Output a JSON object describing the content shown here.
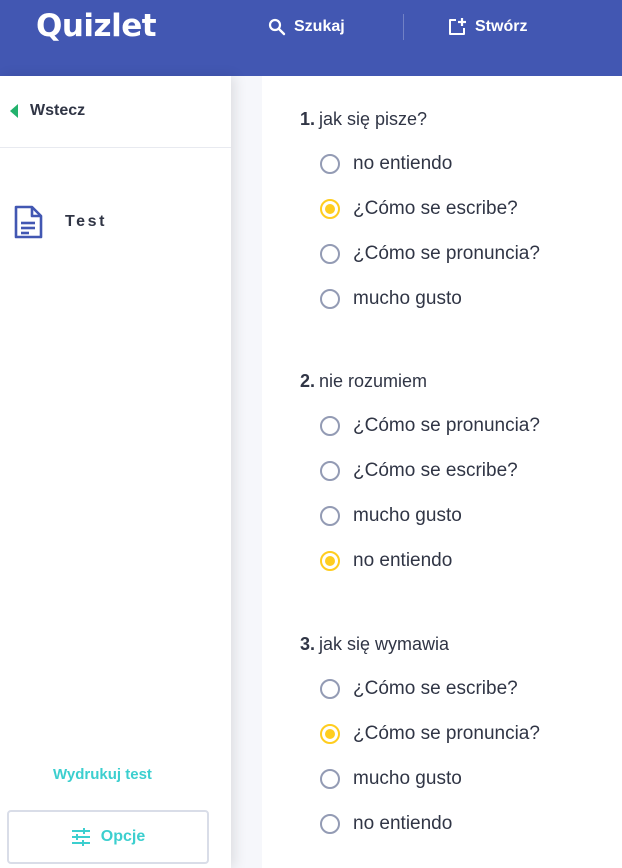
{
  "header": {
    "logo": "Quizlet",
    "search_label": "Szukaj",
    "create_label": "Stwórz",
    "brand_color": "#4257b2"
  },
  "sidebar": {
    "back_label": "Wstecz",
    "mode_label": "Test",
    "print_label": "Wydrukuj test",
    "options_label": "Opcje"
  },
  "questions": [
    {
      "number": "1.",
      "prompt": "jak się pisze?",
      "options": [
        {
          "label": "no entiendo",
          "selected": false
        },
        {
          "label": "¿Cómo se escribe?",
          "selected": true
        },
        {
          "label": "¿Cómo se pronuncia?",
          "selected": false
        },
        {
          "label": "mucho gusto",
          "selected": false
        }
      ]
    },
    {
      "number": "2.",
      "prompt": "nie rozumiem",
      "options": [
        {
          "label": "¿Cómo se pronuncia?",
          "selected": false
        },
        {
          "label": "¿Cómo se escribe?",
          "selected": false
        },
        {
          "label": "mucho gusto",
          "selected": false
        },
        {
          "label": "no entiendo",
          "selected": true
        }
      ]
    },
    {
      "number": "3.",
      "prompt": "jak się wymawia",
      "options": [
        {
          "label": "¿Cómo se escribe?",
          "selected": false
        },
        {
          "label": "¿Cómo se pronuncia?",
          "selected": true
        },
        {
          "label": "mucho gusto",
          "selected": false
        },
        {
          "label": "no entiendo",
          "selected": false
        }
      ]
    }
  ]
}
